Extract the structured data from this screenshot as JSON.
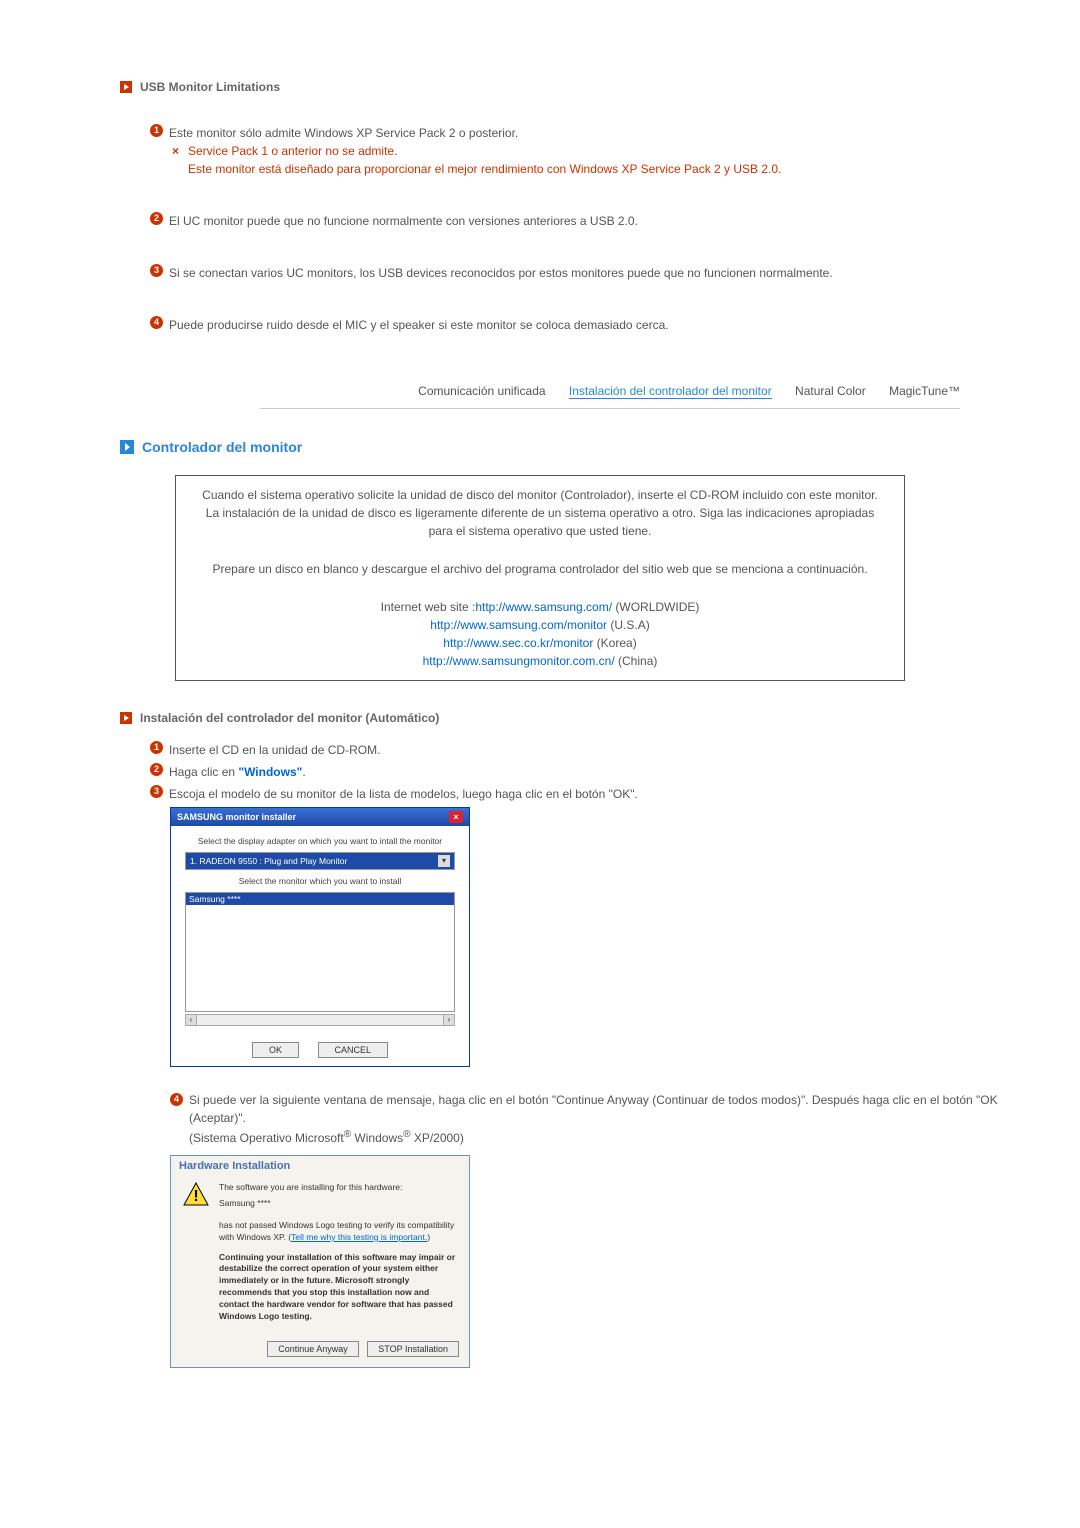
{
  "section1": {
    "title": "USB Monitor Limitations",
    "items": {
      "n1": {
        "line1": "Este monitor sólo admite Windows XP Service Pack 2 o posterior.",
        "x_line": "Service Pack 1 o anterior no se admite.",
        "note": "Este monitor está diseñado para proporcionar el mejor rendimiento con Windows XP Service Pack 2 y USB 2.0."
      },
      "n2": "El UC monitor puede que no funcione normalmente con versiones anteriores a USB 2.0.",
      "n3": "Si se conectan varios UC monitors, los USB devices reconocidos por estos monitores puede que no funcionen normalmente.",
      "n4": "Puede producirse ruido desde el MIC y el speaker si este monitor se coloca demasiado cerca."
    }
  },
  "tabs": {
    "t1": "Comunicación unificada",
    "t2": "Instalación del controlador del monitor",
    "t3": "Natural Color",
    "t4": "MagicTune™"
  },
  "main_title": "Controlador del monitor",
  "info_box": {
    "p1": "Cuando el sistema operativo solicite la unidad de disco del monitor (Controlador), inserte el CD-ROM incluido con este monitor. La instalación de la unidad de disco es ligeramente diferente de un sistema operativo a otro. Siga las indicaciones apropiadas para el sistema operativo que usted tiene.",
    "p2": "Prepare un disco en blanco y descargue el archivo del programa controlador del sitio web que se menciona a continuación.",
    "lead": "Internet web site :",
    "links": {
      "l1_url": "http://www.samsung.com/",
      "l1_sfx": " (WORLDWIDE)",
      "l2_url": "http://www.samsung.com/monitor",
      "l2_sfx": " (U.S.A)",
      "l3_url": "http://www.sec.co.kr/monitor",
      "l3_sfx": " (Korea)",
      "l4_url": "http://www.samsungmonitor.com.cn/",
      "l4_sfx": " (China)"
    }
  },
  "sub1": {
    "title": "Instalación del controlador del monitor (Automático)",
    "s1": "Inserte el CD en la unidad de CD-ROM.",
    "s2_a": "Haga clic en ",
    "s2_b": "\"Windows\"",
    "s2_c": ".",
    "s3": "Escoja el modelo de su monitor de la lista de modelos, luego haga clic en el botón \"OK\".",
    "s4": "Si puede ver la siguiente ventana de mensaje, haga clic en el botón \"Continue Anyway (Continuar de todos modos)\". Después haga clic en el botón \"OK (Aceptar)\".",
    "s4_note_a": "(Sistema Operativo Microsoft",
    "s4_note_b": " Windows",
    "s4_note_c": " XP/2000)"
  },
  "installer": {
    "title": "SAMSUNG monitor installer",
    "lbl1": "Select the display adapter on which you want to intall the monitor",
    "combo": "1. RADEON 9550 : Plug and Play Monitor",
    "lbl2": "Select the monitor which you want to install",
    "sel": "Samsung ****",
    "ok": "OK",
    "cancel": "CANCEL"
  },
  "hw": {
    "title": "Hardware Installation",
    "l1": "The software you are installing for this hardware:",
    "l2": "Samsung ****",
    "l3a": "has not passed Windows Logo testing to verify its compatibility with Windows XP. (",
    "l3b": "Tell me why this testing is important.",
    "l3c": ")",
    "l4": "Continuing your installation of this software may impair or destabilize the correct operation of your system either immediately or in the future. Microsoft strongly recommends that you stop this installation now and contact the hardware vendor for software that has passed Windows Logo testing.",
    "btn1": "Continue Anyway",
    "btn2": "STOP Installation"
  }
}
